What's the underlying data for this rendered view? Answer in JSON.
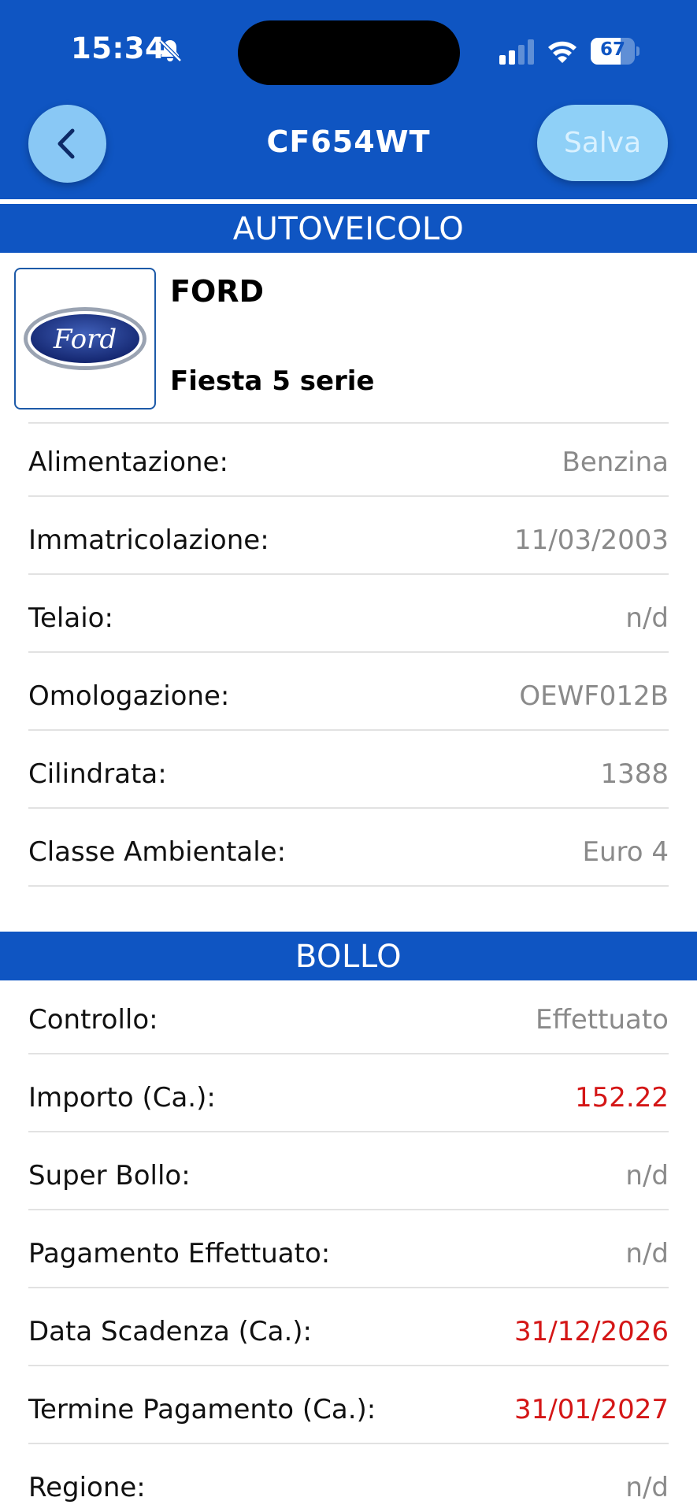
{
  "status_bar": {
    "time": "15:34",
    "battery_percent": "67",
    "battery_level": 0.67,
    "icons": [
      "bell-slash-icon",
      "signal-icon",
      "wifi-icon",
      "battery-icon"
    ]
  },
  "nav": {
    "title": "CF654WT",
    "save_label": "Salva",
    "back_icon": "chevron-left-icon"
  },
  "colors": {
    "primary": "#0f55c2",
    "button_bg": "#89c8f5",
    "value_gray": "#8a8a8a",
    "value_red": "#d41616"
  },
  "autoveicolo": {
    "header": "AUTOVEICOLO",
    "brand": "FORD",
    "model": "Fiesta 5 serie",
    "logo_text": "Ford",
    "rows": [
      {
        "label": "Alimentazione:",
        "value": "Benzina",
        "highlight": false
      },
      {
        "label": "Immatricolazione:",
        "value": "11/03/2003",
        "highlight": false
      },
      {
        "label": "Telaio:",
        "value": "n/d",
        "highlight": false
      },
      {
        "label": "Omologazione:",
        "value": "OEWF012B",
        "highlight": false
      },
      {
        "label": "Cilindrata:",
        "value": "1388",
        "highlight": false
      },
      {
        "label": "Classe Ambientale:",
        "value": "Euro 4",
        "highlight": false
      }
    ]
  },
  "bollo": {
    "header": "BOLLO",
    "rows": [
      {
        "label": "Controllo:",
        "value": "Effettuato",
        "highlight": false
      },
      {
        "label": "Importo (Ca.):",
        "value": "152.22",
        "highlight": true
      },
      {
        "label": "Super Bollo:",
        "value": "n/d",
        "highlight": false
      },
      {
        "label": "Pagamento Effettuato:",
        "value": "n/d",
        "highlight": false
      },
      {
        "label": "Data Scadenza (Ca.):",
        "value": "31/12/2026",
        "highlight": true
      },
      {
        "label": "Termine Pagamento (Ca.):",
        "value": "31/01/2027",
        "highlight": true
      },
      {
        "label": "Regione:",
        "value": "n/d",
        "highlight": false
      }
    ]
  }
}
